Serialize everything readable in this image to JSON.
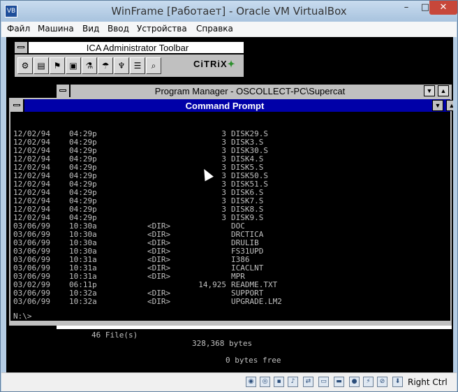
{
  "host": {
    "title": "WinFrame [Работает] - Oracle VM VirtualBox",
    "controls": {
      "minimize": "–",
      "maximize": "□",
      "close": "✕"
    },
    "menu": [
      "Файл",
      "Машина",
      "Вид",
      "Ввод",
      "Устройства",
      "Справка"
    ],
    "status": {
      "host_key": "Right Ctrl"
    }
  },
  "ica_toolbar": {
    "title": "ICA Administrator Toolbar",
    "logo": "CiTRiX",
    "buttons": [
      "tool-1",
      "tool-2",
      "tool-3",
      "tool-4",
      "tool-5",
      "tool-6",
      "tool-7",
      "tool-8",
      "tool-9",
      "tool-10"
    ]
  },
  "program_manager": {
    "title": "Program Manager - OSCOLLECT-PC\\Supercat",
    "min_arrow": "▼",
    "max_arrow": "▲"
  },
  "command_prompt": {
    "title": "Command Prompt",
    "min_arrow": "▼",
    "max_arrow": "▲",
    "listing": [
      {
        "date": "12/02/94",
        "time": "04:29p",
        "dir": "",
        "size": "3",
        "name": "DISK29.S"
      },
      {
        "date": "12/02/94",
        "time": "04:29p",
        "dir": "",
        "size": "3",
        "name": "DISK3.S"
      },
      {
        "date": "12/02/94",
        "time": "04:29p",
        "dir": "",
        "size": "3",
        "name": "DISK30.S"
      },
      {
        "date": "12/02/94",
        "time": "04:29p",
        "dir": "",
        "size": "3",
        "name": "DISK4.S"
      },
      {
        "date": "12/02/94",
        "time": "04:29p",
        "dir": "",
        "size": "3",
        "name": "DISK5.S"
      },
      {
        "date": "12/02/94",
        "time": "04:29p",
        "dir": "",
        "size": "3",
        "name": "DISK50.S"
      },
      {
        "date": "12/02/94",
        "time": "04:29p",
        "dir": "",
        "size": "3",
        "name": "DISK51.S"
      },
      {
        "date": "12/02/94",
        "time": "04:29p",
        "dir": "",
        "size": "3",
        "name": "DISK6.S"
      },
      {
        "date": "12/02/94",
        "time": "04:29p",
        "dir": "",
        "size": "3",
        "name": "DISK7.S"
      },
      {
        "date": "12/02/94",
        "time": "04:29p",
        "dir": "",
        "size": "3",
        "name": "DISK8.S"
      },
      {
        "date": "12/02/94",
        "time": "04:29p",
        "dir": "",
        "size": "3",
        "name": "DISK9.S"
      },
      {
        "date": "03/06/99",
        "time": "10:30a",
        "dir": "<DIR>",
        "size": "",
        "name": "DOC"
      },
      {
        "date": "03/06/99",
        "time": "10:30a",
        "dir": "<DIR>",
        "size": "",
        "name": "DRCTICA"
      },
      {
        "date": "03/06/99",
        "time": "10:30a",
        "dir": "<DIR>",
        "size": "",
        "name": "DRULIB"
      },
      {
        "date": "03/06/99",
        "time": "10:30a",
        "dir": "<DIR>",
        "size": "",
        "name": "FS31UPD"
      },
      {
        "date": "03/06/99",
        "time": "10:31a",
        "dir": "<DIR>",
        "size": "",
        "name": "I386"
      },
      {
        "date": "03/06/99",
        "time": "10:31a",
        "dir": "<DIR>",
        "size": "",
        "name": "ICACLNT"
      },
      {
        "date": "03/06/99",
        "time": "10:31a",
        "dir": "<DIR>",
        "size": "",
        "name": "MPR"
      },
      {
        "date": "03/02/99",
        "time": "06:11p",
        "dir": "",
        "size": "14,925",
        "name": "README.TXT"
      },
      {
        "date": "03/06/99",
        "time": "10:32a",
        "dir": "<DIR>",
        "size": "",
        "name": "SUPPORT"
      },
      {
        "date": "03/06/99",
        "time": "10:32a",
        "dir": "<DIR>",
        "size": "",
        "name": "UPGRADE.LM2"
      }
    ],
    "summary_files": "46 File(s)",
    "summary_bytes": "328,368 bytes",
    "summary_free": "0 bytes free",
    "prompt": "N:\\>"
  }
}
